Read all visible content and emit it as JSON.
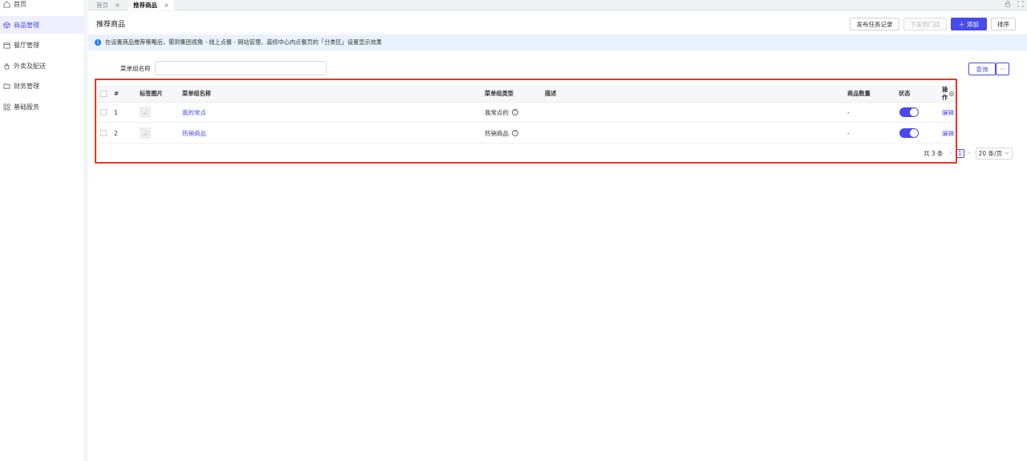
{
  "sidebar": {
    "items": [
      {
        "label": "首页",
        "icon": "home-icon"
      },
      {
        "label": "商品管理",
        "icon": "cube-icon",
        "active": true
      },
      {
        "label": "餐厅管理",
        "icon": "store-icon"
      },
      {
        "label": "外卖及配送",
        "icon": "delivery-icon"
      },
      {
        "label": "财务管理",
        "icon": "folder-icon"
      },
      {
        "label": "基础服务",
        "icon": "grid-icon"
      }
    ]
  },
  "tabs": [
    {
      "label": "首页",
      "close": "×"
    },
    {
      "label": "推荐商品",
      "close": "×",
      "active": true
    }
  ],
  "page": {
    "title": "推荐商品",
    "buttons": {
      "publish_log": "发布任务记录",
      "push_store": "下发到门店",
      "add": "＋ 添加",
      "sort": "排序"
    },
    "notice": "在设置商品推荐策略后，需到集团视角 - 线上点餐 - 网站管理，装修中心内点餐页的「分类区」设置显示效果"
  },
  "filter": {
    "label": "菜单组名称",
    "value": "",
    "placeholder": "",
    "query_button": "查询",
    "more_button": "···"
  },
  "table": {
    "columns": {
      "index": "#",
      "image": "标签图片",
      "name": "菜单组名称",
      "type": "菜单组类型",
      "desc": "描述",
      "count": "商品数量",
      "status": "状态",
      "action": "操作"
    },
    "rows": [
      {
        "index": "1",
        "name": "我的常点",
        "type": "我常点的",
        "desc": "",
        "count": "-",
        "enabled": true,
        "action": "编辑"
      },
      {
        "index": "2",
        "name": "热销商品",
        "type": "热销商品",
        "desc": "",
        "count": "-",
        "enabled": true,
        "action": "编辑"
      }
    ]
  },
  "pagination": {
    "total": "共 3 条",
    "prev": "‹",
    "page": "1",
    "next": "›",
    "page_size": "20 条/页"
  },
  "colors": {
    "accent": "#4a4ae8",
    "highlight": "#ee3322",
    "notice_bg": "#e8f3ff"
  }
}
